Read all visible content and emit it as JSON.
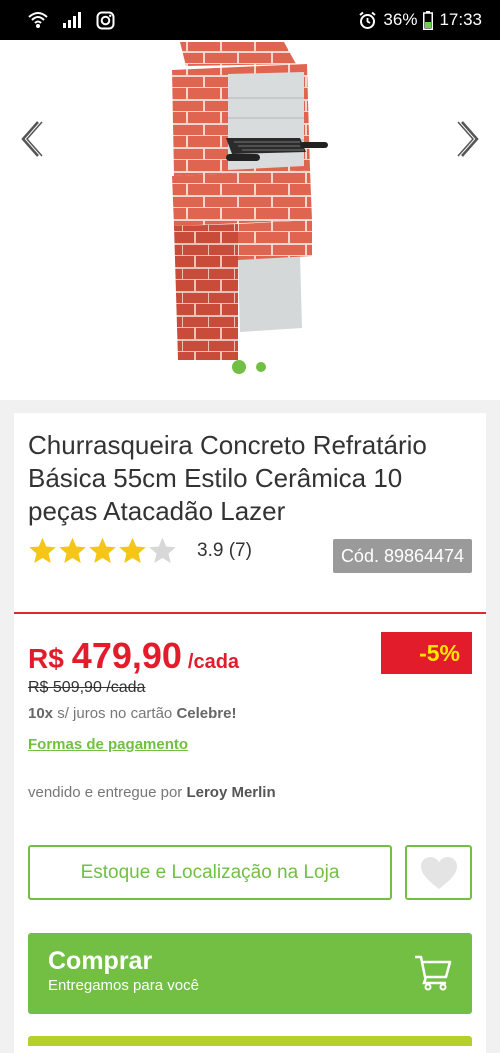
{
  "status_bar": {
    "battery": "36%",
    "time": "17:33",
    "icons": [
      "wifi-icon",
      "signal-icon",
      "instagram-icon",
      "alarm-icon",
      "battery-icon"
    ]
  },
  "gallery": {
    "icons": [
      "chevron-left-icon",
      "chevron-right-icon"
    ],
    "image_count": 2,
    "active_index": 0
  },
  "product": {
    "title": "Churrasqueira Concreto Refratário Básica 55cm Estilo Cerâmica 10 peças Atacadão Lazer",
    "rating_value": 3.9,
    "rating_text": "3.9 (7)",
    "code": "Cód. 89864474"
  },
  "pricing": {
    "currency": "R$",
    "price": "479,90",
    "unit": "/cada",
    "discount": "-5%",
    "old_price": "R$ 509,90 /cada",
    "installments_count": "10x",
    "installments_mid": " s/ juros no cartão ",
    "installments_card": "Celebre!",
    "payment_link": "Formas de pagamento",
    "seller_prefix": "vendido e entregue por ",
    "seller_name": "Leroy Merlin"
  },
  "actions": {
    "stock_label": "Estoque e Localização na Loja",
    "buy_label": "Comprar",
    "buy_sub": "Entregamos para você"
  },
  "colors": {
    "brand_green": "#72bf44",
    "price_red": "#e21c2b",
    "discount_text": "#ffe600",
    "star_filled": "#f5c518",
    "star_empty": "#d8d8d8"
  }
}
